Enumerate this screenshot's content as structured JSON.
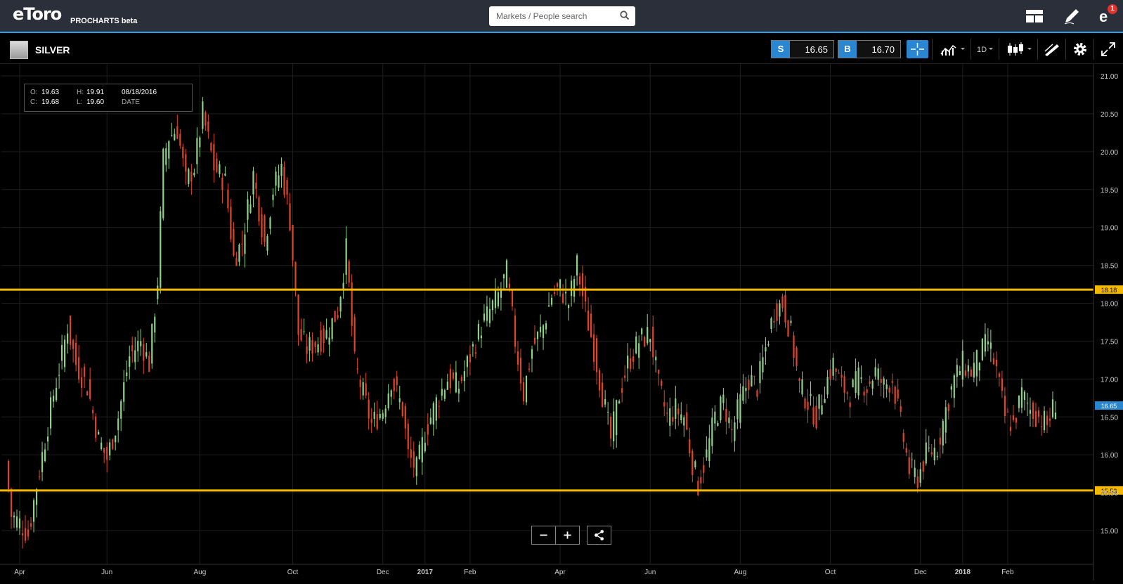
{
  "topbar": {
    "logo": "eToro",
    "logo_sub": "PROCHARTS beta",
    "search_placeholder": "Markets / People search",
    "notification_count": "1"
  },
  "header": {
    "instrument": "SILVER",
    "sell_label": "S",
    "sell_price": "16.65",
    "buy_label": "B",
    "buy_price": "16.70",
    "timeframe": "1D"
  },
  "ohlc": {
    "o_label": "O:",
    "o_value": "19.63",
    "h_label": "H:",
    "h_value": "19.91",
    "c_label": "C:",
    "c_value": "19.68",
    "l_label": "L:",
    "l_value": "19.60",
    "date": "08/18/2016",
    "date_label": "DATE"
  },
  "colors": {
    "up": "#8fd18a",
    "down": "#e0452b",
    "level_line": "#f5b800",
    "current_price_tag": "#2a86d1",
    "accent": "#2aa4e6"
  },
  "chart_data": {
    "type": "candlestick",
    "instrument": "SILVER",
    "y_ticks": [
      15.0,
      15.5,
      16.0,
      16.5,
      17.0,
      17.5,
      18.0,
      18.5,
      19.0,
      19.5,
      20.0,
      20.5,
      21.0
    ],
    "y_tick_labels": [
      "15.00",
      "15.50",
      "16.00",
      "16.50",
      "17.00",
      "17.50",
      "18.00",
      "18.50",
      "19.00",
      "19.50",
      "20.00",
      "20.50",
      "21.00"
    ],
    "ylim": [
      14.8,
      21.15
    ],
    "x_tick_labels": [
      "Apr",
      "Jun",
      "Aug",
      "Oct",
      "Dec",
      "2017",
      "Feb",
      "Apr",
      "Jun",
      "Aug",
      "Oct",
      "Dec",
      "2018",
      "Feb"
    ],
    "x_tick_index": [
      5,
      36,
      69,
      102,
      134,
      149,
      165,
      197,
      229,
      261,
      293,
      325,
      340,
      356
    ],
    "horizontal_levels": [
      {
        "value": 18.18,
        "label": "18.18"
      },
      {
        "value": 15.53,
        "label": "15.53"
      }
    ],
    "current_price": {
      "value": 16.65,
      "label": "16.65"
    },
    "close_series_path": [
      [
        0,
        15.9
      ],
      [
        2,
        15.2
      ],
      [
        5,
        15.1
      ],
      [
        8,
        14.95
      ],
      [
        11,
        15.6
      ],
      [
        14,
        16.2
      ],
      [
        17,
        16.8
      ],
      [
        20,
        17.3
      ],
      [
        22,
        17.7
      ],
      [
        25,
        17.2
      ],
      [
        29,
        16.9
      ],
      [
        33,
        16.2
      ],
      [
        36,
        15.95
      ],
      [
        40,
        16.5
      ],
      [
        44,
        17.3
      ],
      [
        48,
        17.5
      ],
      [
        51,
        17.2
      ],
      [
        54,
        18.3
      ],
      [
        56,
        19.9
      ],
      [
        58,
        20.2
      ],
      [
        61,
        20.3
      ],
      [
        64,
        19.6
      ],
      [
        67,
        19.8
      ],
      [
        70,
        20.5
      ],
      [
        74,
        19.8
      ],
      [
        78,
        19.6
      ],
      [
        81,
        18.6
      ],
      [
        84,
        18.8
      ],
      [
        88,
        19.7
      ],
      [
        92,
        18.8
      ],
      [
        95,
        19.5
      ],
      [
        98,
        19.8
      ],
      [
        101,
        19.1
      ],
      [
        104,
        17.6
      ],
      [
        107,
        17.4
      ],
      [
        111,
        17.5
      ],
      [
        114,
        17.6
      ],
      [
        118,
        17.9
      ],
      [
        121,
        18.7
      ],
      [
        124,
        17.2
      ],
      [
        127,
        16.8
      ],
      [
        130,
        16.4
      ],
      [
        134,
        16.6
      ],
      [
        137,
        17.0
      ],
      [
        141,
        16.6
      ],
      [
        143,
        16.0
      ],
      [
        146,
        15.8
      ],
      [
        149,
        16.3
      ],
      [
        153,
        16.7
      ],
      [
        157,
        17.0
      ],
      [
        161,
        16.9
      ],
      [
        165,
        17.3
      ],
      [
        169,
        17.7
      ],
      [
        172,
        17.9
      ],
      [
        175,
        18.1
      ],
      [
        178,
        18.4
      ],
      [
        181,
        17.5
      ],
      [
        184,
        16.8
      ],
      [
        187,
        17.4
      ],
      [
        191,
        17.7
      ],
      [
        194,
        18.1
      ],
      [
        197,
        18.2
      ],
      [
        200,
        18.0
      ],
      [
        203,
        18.5
      ],
      [
        206,
        17.9
      ],
      [
        209,
        17.4
      ],
      [
        212,
        16.8
      ],
      [
        215,
        16.2
      ],
      [
        218,
        16.8
      ],
      [
        221,
        17.2
      ],
      [
        225,
        17.5
      ],
      [
        229,
        17.6
      ],
      [
        232,
        16.9
      ],
      [
        235,
        16.5
      ],
      [
        238,
        16.6
      ],
      [
        241,
        16.5
      ],
      [
        244,
        15.9
      ],
      [
        246,
        15.6
      ],
      [
        249,
        16.0
      ],
      [
        252,
        16.5
      ],
      [
        255,
        16.7
      ],
      [
        258,
        16.3
      ],
      [
        261,
        16.7
      ],
      [
        264,
        17.0
      ],
      [
        267,
        16.9
      ],
      [
        270,
        17.4
      ],
      [
        273,
        17.9
      ],
      [
        276,
        18.0
      ],
      [
        279,
        17.6
      ],
      [
        282,
        16.9
      ],
      [
        285,
        16.7
      ],
      [
        288,
        16.5
      ],
      [
        291,
        16.9
      ],
      [
        294,
        17.2
      ],
      [
        297,
        16.9
      ],
      [
        300,
        16.8
      ],
      [
        303,
        17.0
      ],
      [
        306,
        16.9
      ],
      [
        309,
        17.1
      ],
      [
        312,
        16.9
      ],
      [
        315,
        17.0
      ],
      [
        318,
        16.4
      ],
      [
        321,
        15.8
      ],
      [
        324,
        15.7
      ],
      [
        327,
        16.0
      ],
      [
        331,
        16.1
      ],
      [
        334,
        16.6
      ],
      [
        337,
        17.0
      ],
      [
        340,
        17.2
      ],
      [
        343,
        17.1
      ],
      [
        346,
        17.3
      ],
      [
        349,
        17.5
      ],
      [
        352,
        17.1
      ],
      [
        355,
        16.5
      ],
      [
        358,
        16.4
      ],
      [
        361,
        16.8
      ],
      [
        364,
        16.6
      ],
      [
        367,
        16.5
      ],
      [
        370,
        16.4
      ],
      [
        373,
        16.7
      ]
    ]
  }
}
